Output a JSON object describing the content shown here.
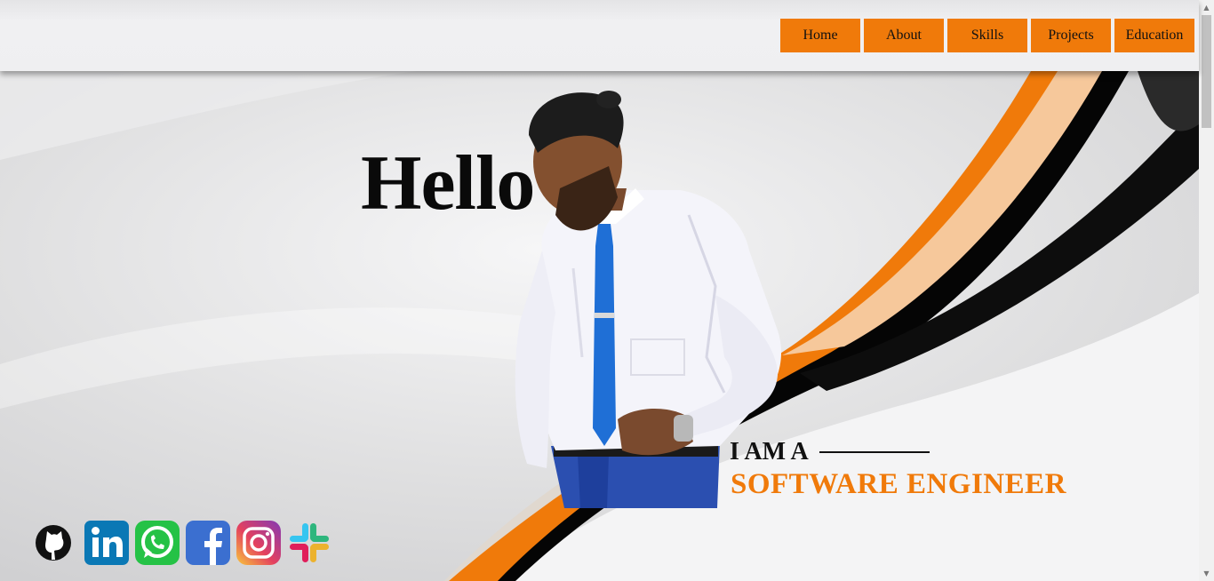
{
  "nav": {
    "items": [
      {
        "label": "Home"
      },
      {
        "label": "About"
      },
      {
        "label": "Skills"
      },
      {
        "label": "Projects"
      },
      {
        "label": "Education"
      }
    ]
  },
  "hero": {
    "greeting": "Hello",
    "intro": "I AM A",
    "role": "SOFTWARE ENGINEER"
  },
  "social": [
    {
      "icon": "github-icon"
    },
    {
      "icon": "linkedin-icon"
    },
    {
      "icon": "whatsapp-icon"
    },
    {
      "icon": "facebook-icon"
    },
    {
      "icon": "instagram-icon"
    },
    {
      "icon": "slack-icon"
    }
  ],
  "colors": {
    "accent": "#f07a0a",
    "text": "#111111",
    "background": "#e3e3e5"
  }
}
